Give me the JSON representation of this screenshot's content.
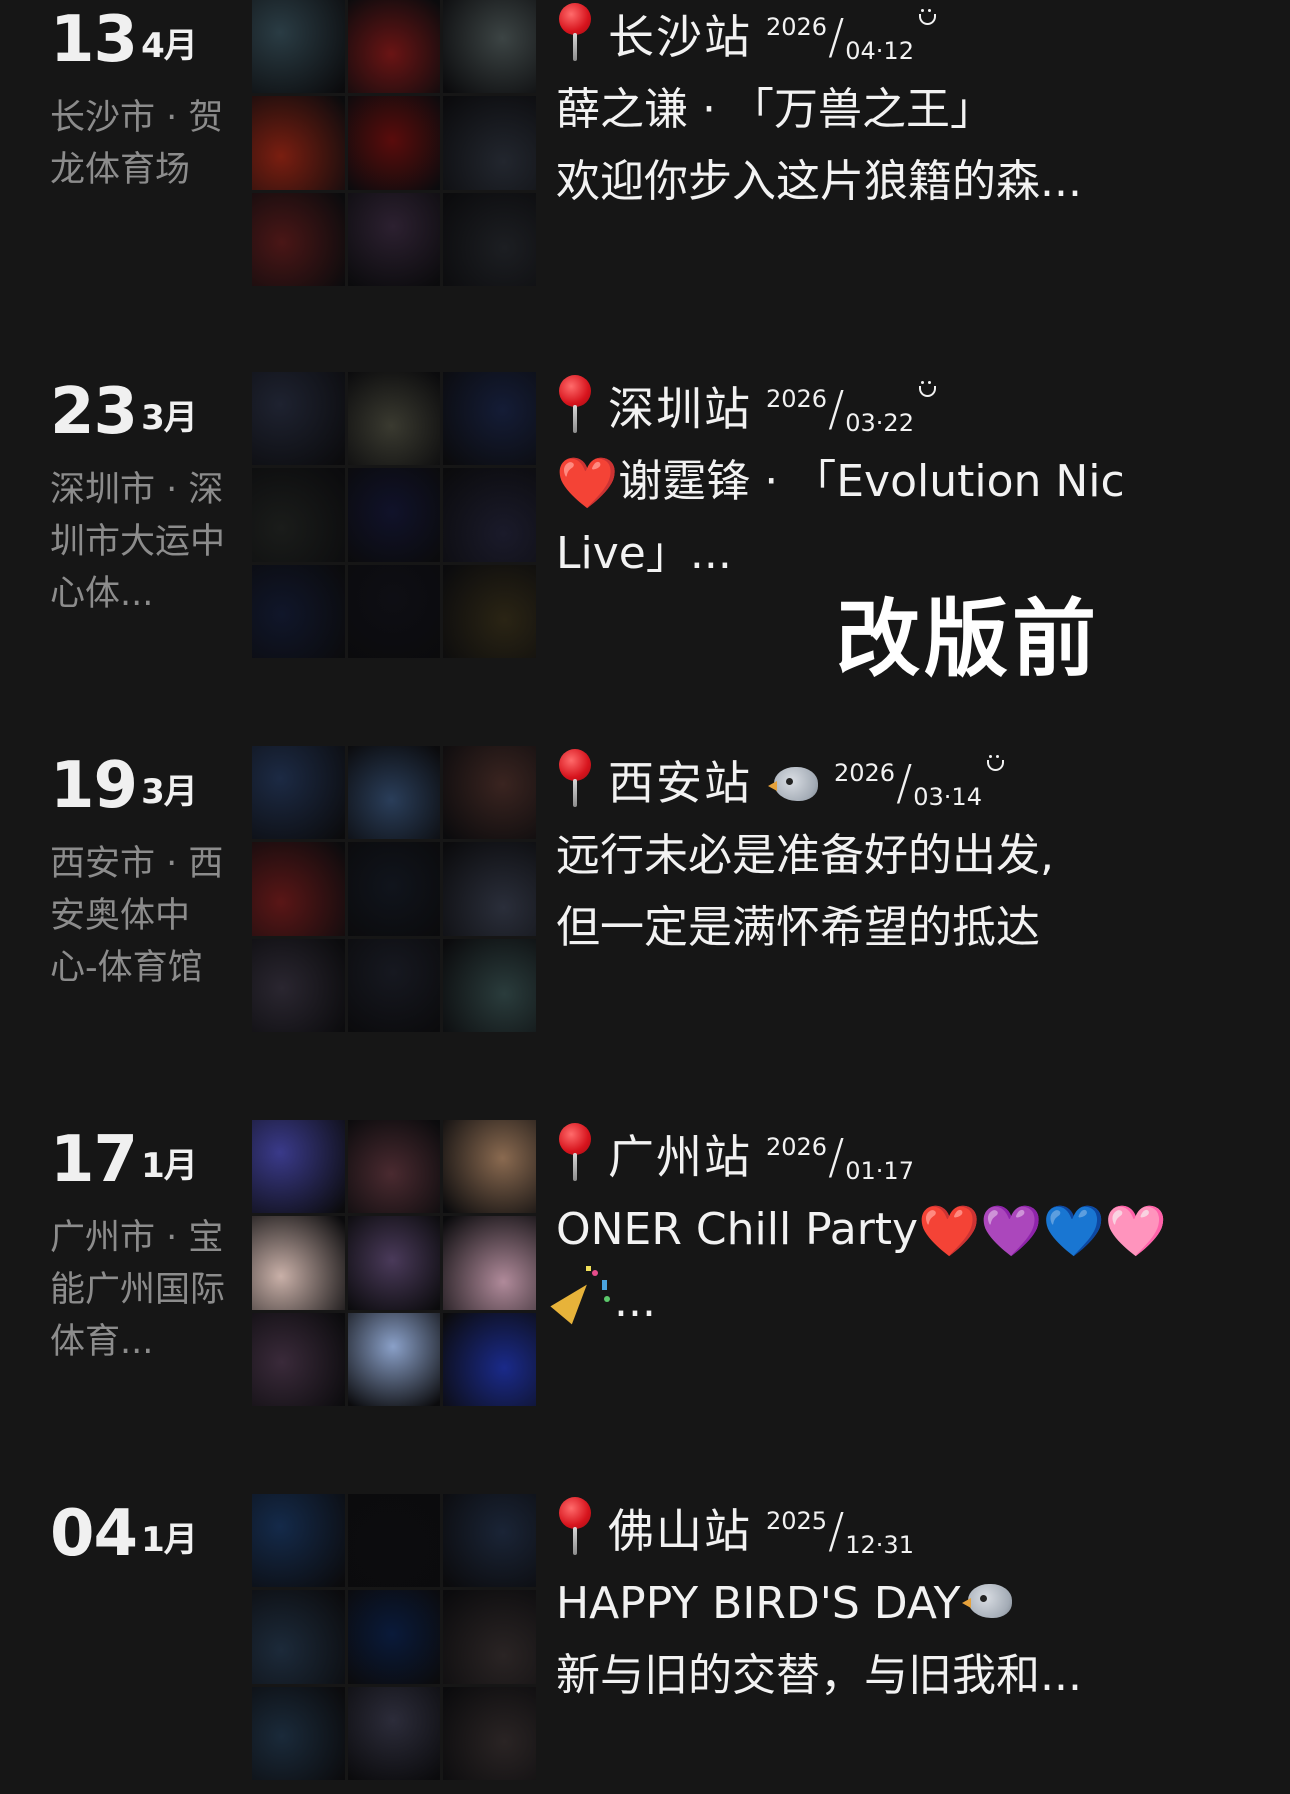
{
  "overlay_label": "改版前",
  "entries": [
    {
      "day": "13",
      "month": "4月",
      "venue": "长沙市 · 贺龙体育场",
      "station": "长沙站",
      "year": "2026",
      "md": "04·12",
      "show_smile": true,
      "line1": "薛之谦 · 「万兽之王」",
      "line2": "欢迎你步入这片狼籍的森...",
      "thumbs": [
        "#2a3c44",
        "#6a1414",
        "#3c4444",
        "#7a1e10",
        "#5a0c0c",
        "#22262e",
        "#4a1616",
        "#2c2030",
        "#1c1e22"
      ]
    },
    {
      "day": "23",
      "month": "3月",
      "venue": "深圳市 · 深圳市大运中心体...",
      "station": "深圳站",
      "year": "2026",
      "md": "03·22",
      "show_smile": true,
      "line1_prefix_icon": "red-heart-icon",
      "line1": "谢霆锋 · 「Evolution Nic",
      "line2": "Live」...",
      "thumbs": [
        "#1e2230",
        "#3a3a30",
        "#141c36",
        "#1a1c1a",
        "#10122a",
        "#1a1a2a",
        "#10162a",
        "#0e0e14",
        "#2a2414"
      ]
    },
    {
      "day": "19",
      "month": "3月",
      "venue": "西安市 · 西安奥体中心-体育馆",
      "station": "西安站",
      "year": "2026",
      "md": "03·14",
      "show_smile": true,
      "show_bird": true,
      "line1": "远行未必是准备好的出发,",
      "line2": "但一定是满怀希望的抵达",
      "thumbs": [
        "#1c2a44",
        "#2a3e5a",
        "#3a2420",
        "#5a1616",
        "#10141c",
        "#2a2e3a",
        "#2a2630",
        "#161820",
        "#2a3c3c"
      ]
    },
    {
      "day": "17",
      "month": "1月",
      "venue": "广州市 · 宝能广州国际体育...",
      "station": "广州站",
      "year": "2026",
      "md": "01·17",
      "show_smile": false,
      "line1": "ONER Chill Party",
      "hearts": [
        "❤️",
        "💜",
        "💙",
        "🩷"
      ],
      "line2": "...",
      "thumbs": [
        "#3a3a8a",
        "#4a2a30",
        "#8a6a50",
        "#c9b0a8",
        "#4a3a5a",
        "#b08a9a",
        "#3a2a3a",
        "#8aa0c8",
        "#1a2a8a"
      ]
    },
    {
      "day": "04",
      "month": "1月",
      "venue": "",
      "station": "佛山站",
      "year": "2025",
      "md": "12·31",
      "show_smile": false,
      "line1": "HAPPY BIRD'S DAY",
      "line2": "新与旧的交替，与旧我和...",
      "thumbs": [
        "#142a4a",
        "#0c0c0e",
        "#1a2436",
        "#1c2a3a",
        "#0a1a3a",
        "#2a2424",
        "#1a2a3a",
        "#2c2c3a",
        "#2a2424"
      ]
    }
  ]
}
